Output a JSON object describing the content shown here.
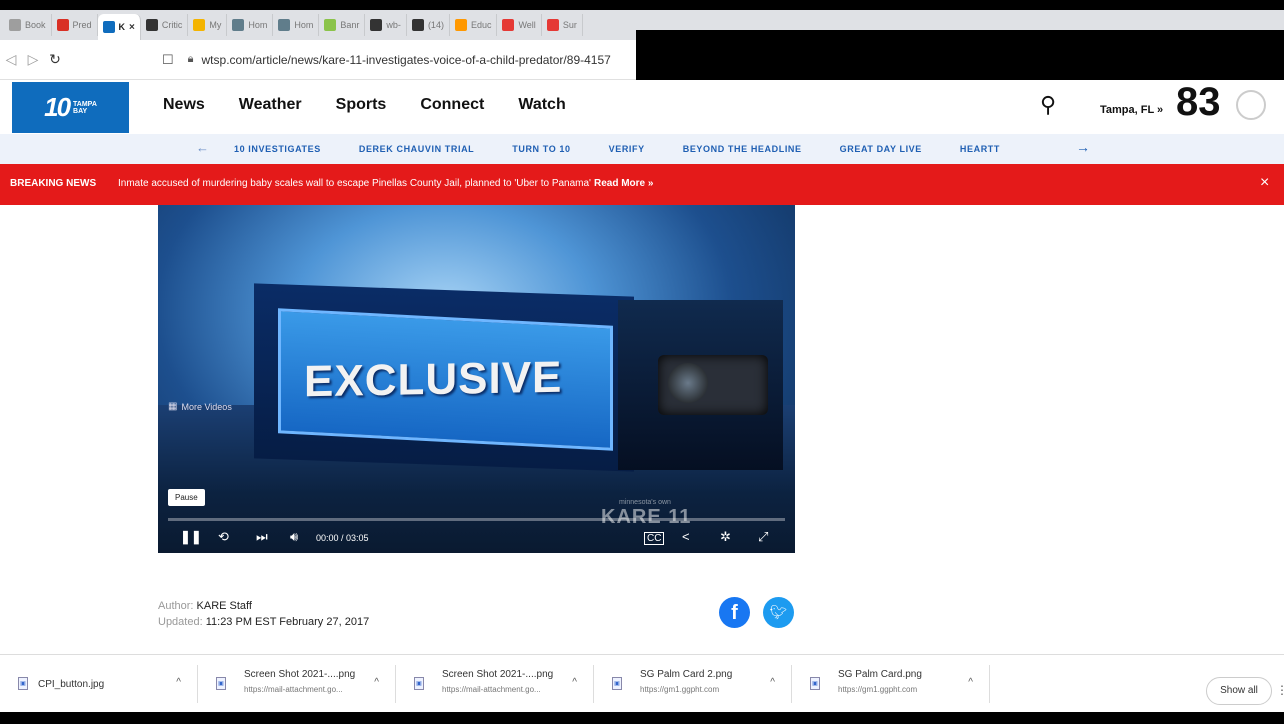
{
  "browser": {
    "tabs": [
      {
        "label": "Book",
        "icon": "bookmark-icon",
        "color": "#9e9e9e"
      },
      {
        "label": "Pred",
        "icon": "gmail-icon",
        "color": "#d93025"
      },
      {
        "label": "K",
        "icon": "wtsp-icon",
        "color": "#0f6cbd",
        "active": true
      },
      {
        "label": "Critic",
        "icon": "globe-icon",
        "color": "#333333"
      },
      {
        "label": "My",
        "icon": "drive-icon",
        "color": "#f4b400"
      },
      {
        "label": "Hom",
        "icon": "bank-icon",
        "color": "#607d8b"
      },
      {
        "label": "Hom",
        "icon": "bank-icon",
        "color": "#607d8b"
      },
      {
        "label": "Banr",
        "icon": "arrow-icon",
        "color": "#8bc34a"
      },
      {
        "label": "wb-",
        "icon": "github-icon",
        "color": "#333333"
      },
      {
        "label": "(14)",
        "icon": "box-icon",
        "color": "#333333"
      },
      {
        "label": "Educ",
        "icon": "rainbow-icon",
        "color": "#ff9800"
      },
      {
        "label": "Well",
        "icon": "flag-icon",
        "color": "#e53935"
      },
      {
        "label": "Sur",
        "icon": "survey-icon",
        "color": "#e53935"
      }
    ],
    "tab_close": "×",
    "url": "wtsp.com/article/news/kare-11-investigates-voice-of-a-child-predator/89-4157"
  },
  "site": {
    "logo_number": "10",
    "logo_sub_1": "TAMPA",
    "logo_sub_2": "BAY",
    "nav": [
      "News",
      "Weather",
      "Sports",
      "Connect",
      "Watch"
    ],
    "location": "Tampa, FL »",
    "temperature": "83",
    "subnav": [
      "10 INVESTIGATES",
      "DEREK CHAUVIN TRIAL",
      "TURN TO 10",
      "VERIFY",
      "BEYOND THE HEADLINE",
      "GREAT DAY LIVE",
      "HEARTT"
    ]
  },
  "breaking": {
    "label": "BREAKING NEWS",
    "text": "Inmate accused of murdering baby scales wall to escape Pinellas County Jail, planned to 'Uber to Panama'",
    "more": "Read More »",
    "close": "×"
  },
  "video": {
    "headline": "EXCLUSIVE",
    "more_videos": "More Videos",
    "tooltip": "Pause",
    "time": "00:00 / 03:05",
    "station_small": "minnesota's own",
    "station": "KARE 11",
    "progress": 0.0
  },
  "article": {
    "author_label": "Author:",
    "author": "KARE Staff",
    "updated_label": "Updated:",
    "updated": "11:23 PM EST February 27, 2017"
  },
  "downloads": {
    "items": [
      {
        "name": "CPI_button.jpg",
        "source": ""
      },
      {
        "name": "Screen Shot 2021-....png",
        "source": "https://mail-attachment.go..."
      },
      {
        "name": "Screen Shot 2021-....png",
        "source": "https://mail-attachment.go..."
      },
      {
        "name": "SG Palm Card 2.png",
        "source": "https://gm1.ggpht.com"
      },
      {
        "name": "SG Palm Card.png",
        "source": "https://gm1.ggpht.com"
      }
    ],
    "show_all": "Show all"
  }
}
